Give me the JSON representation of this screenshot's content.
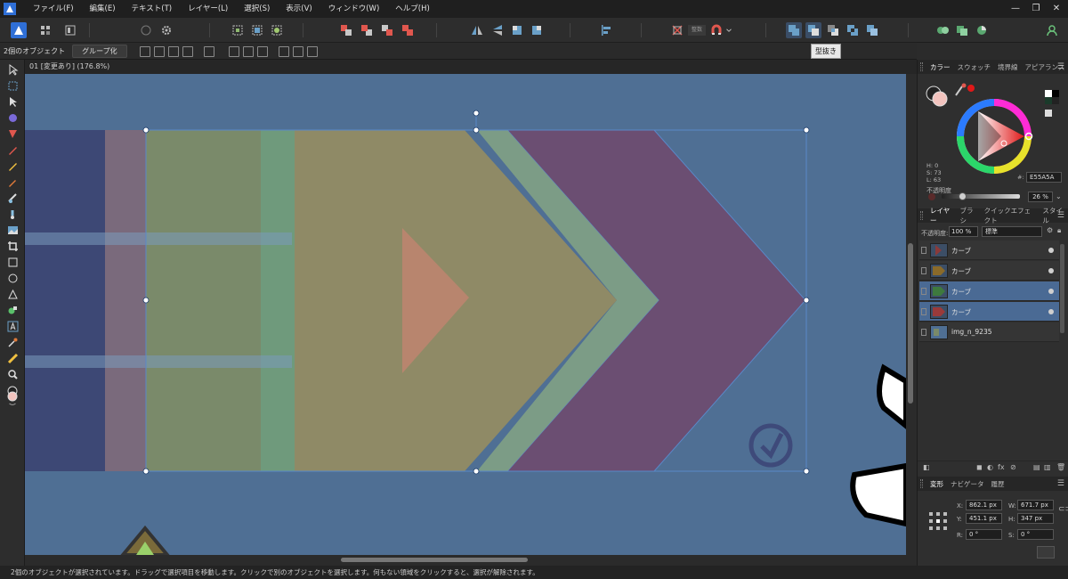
{
  "menubar": {
    "items": [
      "ファイル(F)",
      "編集(E)",
      "テキスト(T)",
      "レイヤー(L)",
      "選択(S)",
      "表示(V)",
      "ウィンドウ(W)",
      "ヘルプ(H)"
    ],
    "minimize": "—",
    "maximize": "❐",
    "close": "✕"
  },
  "toolbar": {
    "tooltip": "型抜き",
    "zoom_field": "整数"
  },
  "context": {
    "selection_label": "2個のオブジェクト",
    "group_button": "グループ化"
  },
  "document": {
    "tab_title": "01 [変更あり] (176.8%)"
  },
  "status": {
    "message": "2個のオブジェクトが選択されています。ドラッグで選択項目を移動します。クリックで別のオブジェクトを選択します。何もない領域をクリックすると、選択が解除されます。"
  },
  "color_panel": {
    "tabs": [
      "カラー",
      "スウォッチ",
      "境界線",
      "アピアランス"
    ],
    "h": "H: 0",
    "s": "S: 73",
    "l": "L: 63",
    "hex_label": "#:",
    "hex": "E55A5A",
    "opacity_label": "不透明度",
    "opacity_value": "26 %",
    "opacity": 0.26,
    "current_color": "#e55a5a"
  },
  "layers_panel": {
    "tabs": [
      "レイヤー",
      "ブラシ",
      "クイックエフェクト",
      "スタイル"
    ],
    "opacity_label": "不透明度:",
    "opacity_value": "100 %",
    "blend_mode": "標準",
    "layers": [
      {
        "name": "カーブ",
        "selected": false,
        "color": "#8a3a3a"
      },
      {
        "name": "カーブ",
        "selected": false,
        "color": "#8a6a2a"
      },
      {
        "name": "カーブ",
        "selected": true,
        "color": "#3e7a3e"
      },
      {
        "name": "カーブ",
        "selected": true,
        "color": "#9a3a3a"
      },
      {
        "name": "img_n_9235",
        "selected": false,
        "color": "#4f6f94"
      }
    ]
  },
  "transform_panel": {
    "tabs": [
      "変形",
      "ナビゲータ",
      "履歴"
    ],
    "x_label": "X:",
    "x": "862.1 px",
    "y_label": "Y:",
    "y": "451.1 px",
    "w_label": "W:",
    "w": "671.7 px",
    "h_label": "H:",
    "h": "347 px",
    "r_label": "R:",
    "r": "0 °",
    "s_label": "S:",
    "s": "0 °"
  }
}
